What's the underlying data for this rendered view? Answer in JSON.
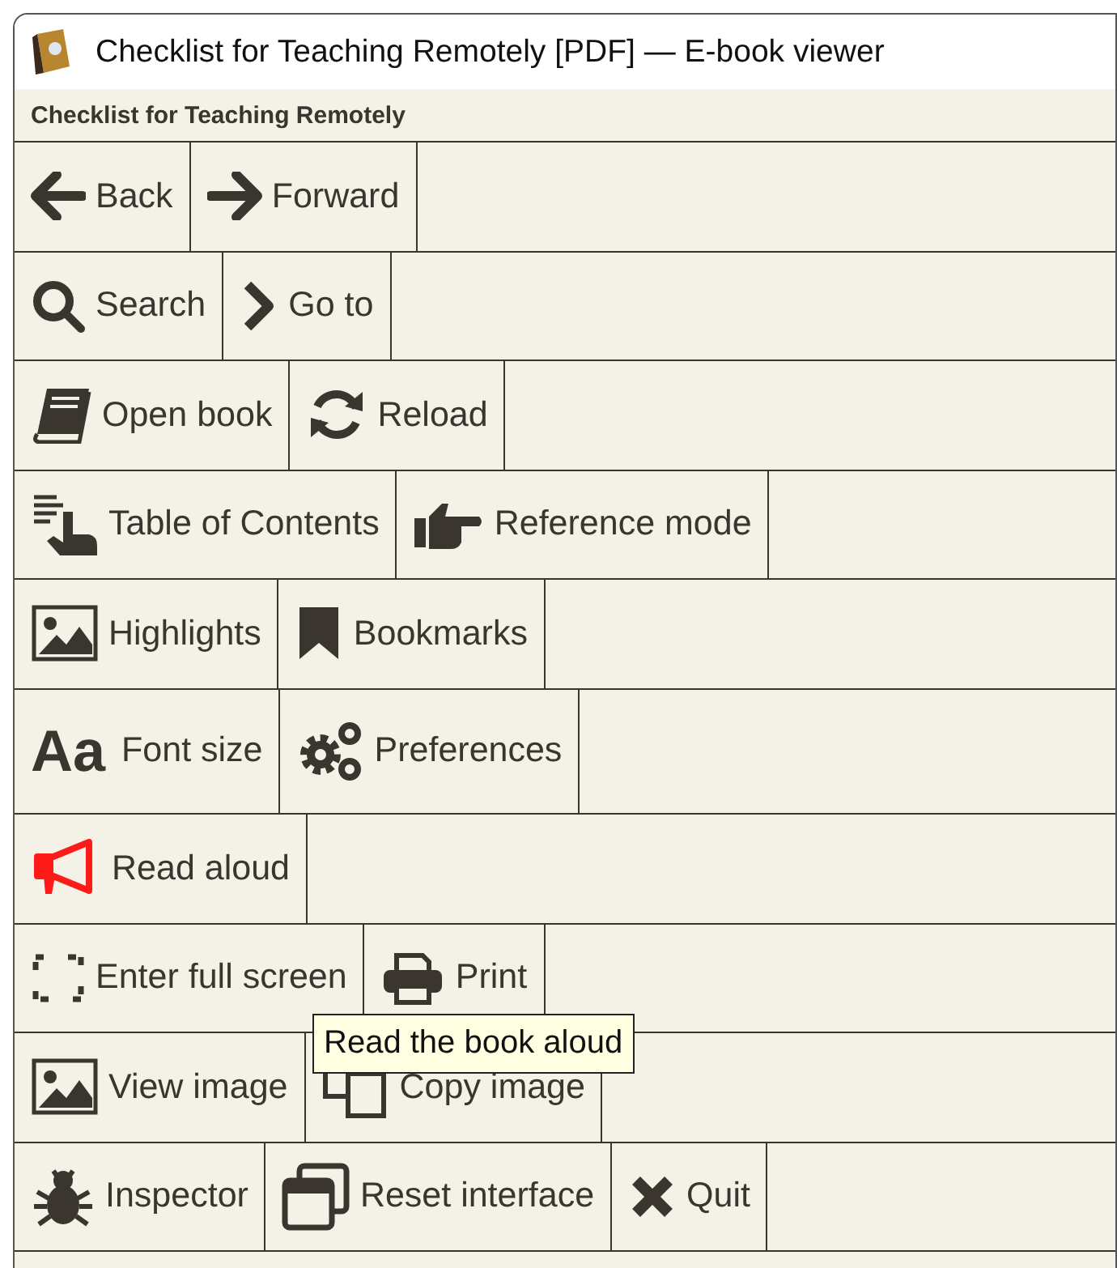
{
  "window": {
    "title": "Checklist for Teaching Remotely [PDF] — E-book viewer"
  },
  "book_title": "Checklist for Teaching Remotely",
  "toolbar_rows": [
    {
      "buttons": [
        {
          "label": "Back"
        },
        {
          "label": "Forward"
        }
      ]
    },
    {
      "buttons": [
        {
          "label": "Search"
        },
        {
          "label": "Go to"
        }
      ]
    },
    {
      "buttons": [
        {
          "label": "Open book"
        },
        {
          "label": "Reload"
        }
      ]
    },
    {
      "buttons": [
        {
          "label": "Table of Contents"
        },
        {
          "label": "Reference mode"
        }
      ]
    },
    {
      "buttons": [
        {
          "label": "Highlights"
        },
        {
          "label": "Bookmarks"
        }
      ]
    },
    {
      "buttons": [
        {
          "label": "Font size",
          "icon_text": "Aa"
        },
        {
          "label": "Preferences"
        }
      ]
    },
    {
      "buttons": [
        {
          "label": "Read aloud"
        }
      ]
    },
    {
      "buttons": [
        {
          "label": "Enter full screen"
        },
        {
          "label": "Print"
        }
      ]
    },
    {
      "buttons": [
        {
          "label": "View image"
        },
        {
          "label": "Copy image"
        }
      ]
    },
    {
      "buttons": [
        {
          "label": "Inspector"
        },
        {
          "label": "Reset interface"
        },
        {
          "label": "Quit"
        }
      ]
    }
  ],
  "tooltip": "Read the book aloud"
}
